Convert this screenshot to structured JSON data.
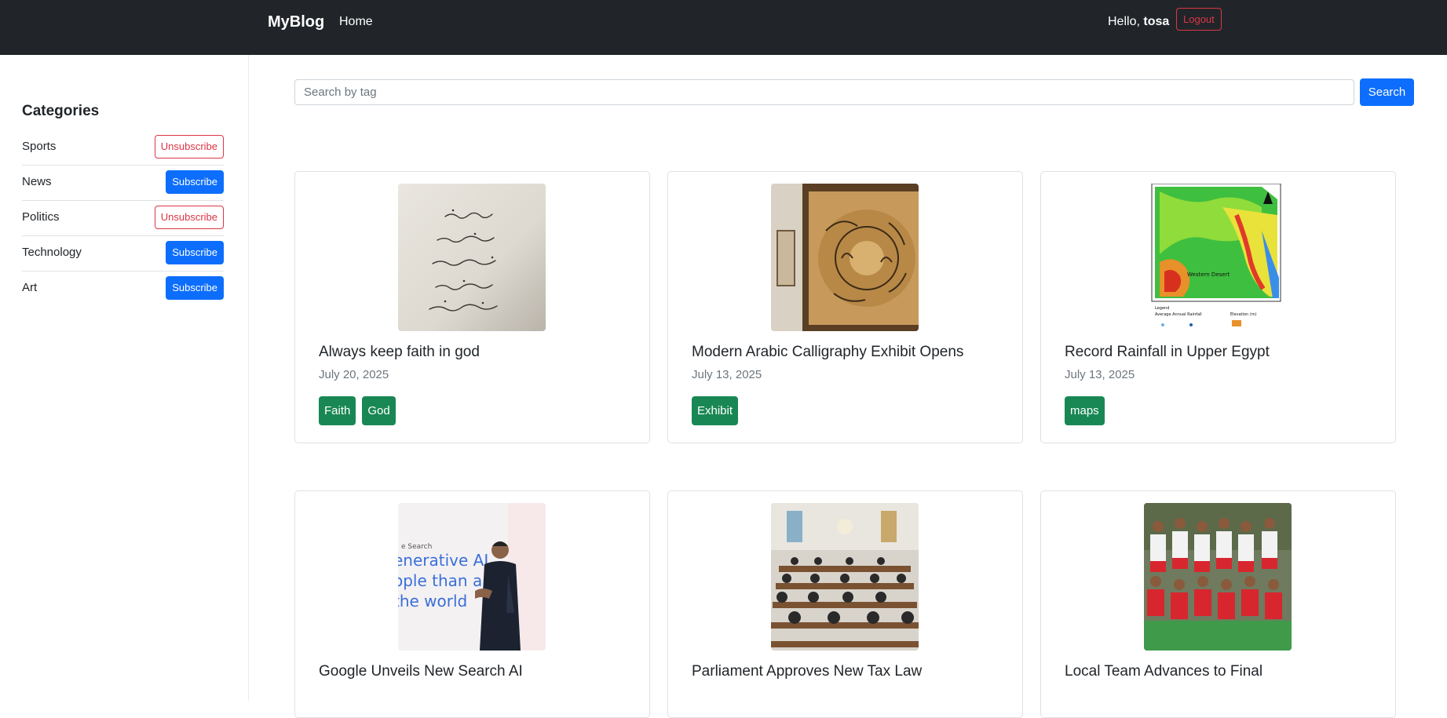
{
  "navbar": {
    "brand": "MyBlog",
    "home": "Home",
    "greeting": "Hello,",
    "username": "tosa",
    "logout": "Logout"
  },
  "sidebar": {
    "title": "Categories",
    "items": [
      {
        "name": "Sports",
        "action": "Unsubscribe",
        "subscribed": true
      },
      {
        "name": "News",
        "action": "Subscribe",
        "subscribed": false
      },
      {
        "name": "Politics",
        "action": "Unsubscribe",
        "subscribed": true
      },
      {
        "name": "Technology",
        "action": "Subscribe",
        "subscribed": false
      },
      {
        "name": "Art",
        "action": "Subscribe",
        "subscribed": false
      }
    ]
  },
  "search": {
    "placeholder": "Search by tag",
    "button": "Search"
  },
  "posts": [
    {
      "title": "Always keep faith in god",
      "date": "July 20, 2025",
      "tags": [
        "Faith",
        "God"
      ],
      "image": "arabic-handwriting-photo"
    },
    {
      "title": "Modern Arabic Calligraphy Exhibit Opens",
      "date": "July 13, 2025",
      "tags": [
        "Exhibit"
      ],
      "image": "calligraphy-exhibit-photo"
    },
    {
      "title": "Record Rainfall in Upper Egypt",
      "date": "July 13, 2025",
      "tags": [
        "maps"
      ],
      "image": "egypt-rainfall-map"
    },
    {
      "title": "Google Unveils New Search AI",
      "date": "",
      "tags": [],
      "image": "presenter-photo"
    },
    {
      "title": "Parliament Approves New Tax Law",
      "date": "",
      "tags": [],
      "image": "parliament-hall-photo"
    },
    {
      "title": "Local Team Advances to Final",
      "date": "",
      "tags": [],
      "image": "football-team-photo"
    }
  ],
  "colors": {
    "navbar_bg": "#212529",
    "primary": "#0d6efd",
    "danger": "#dc3545",
    "tag_green": "#198754"
  }
}
